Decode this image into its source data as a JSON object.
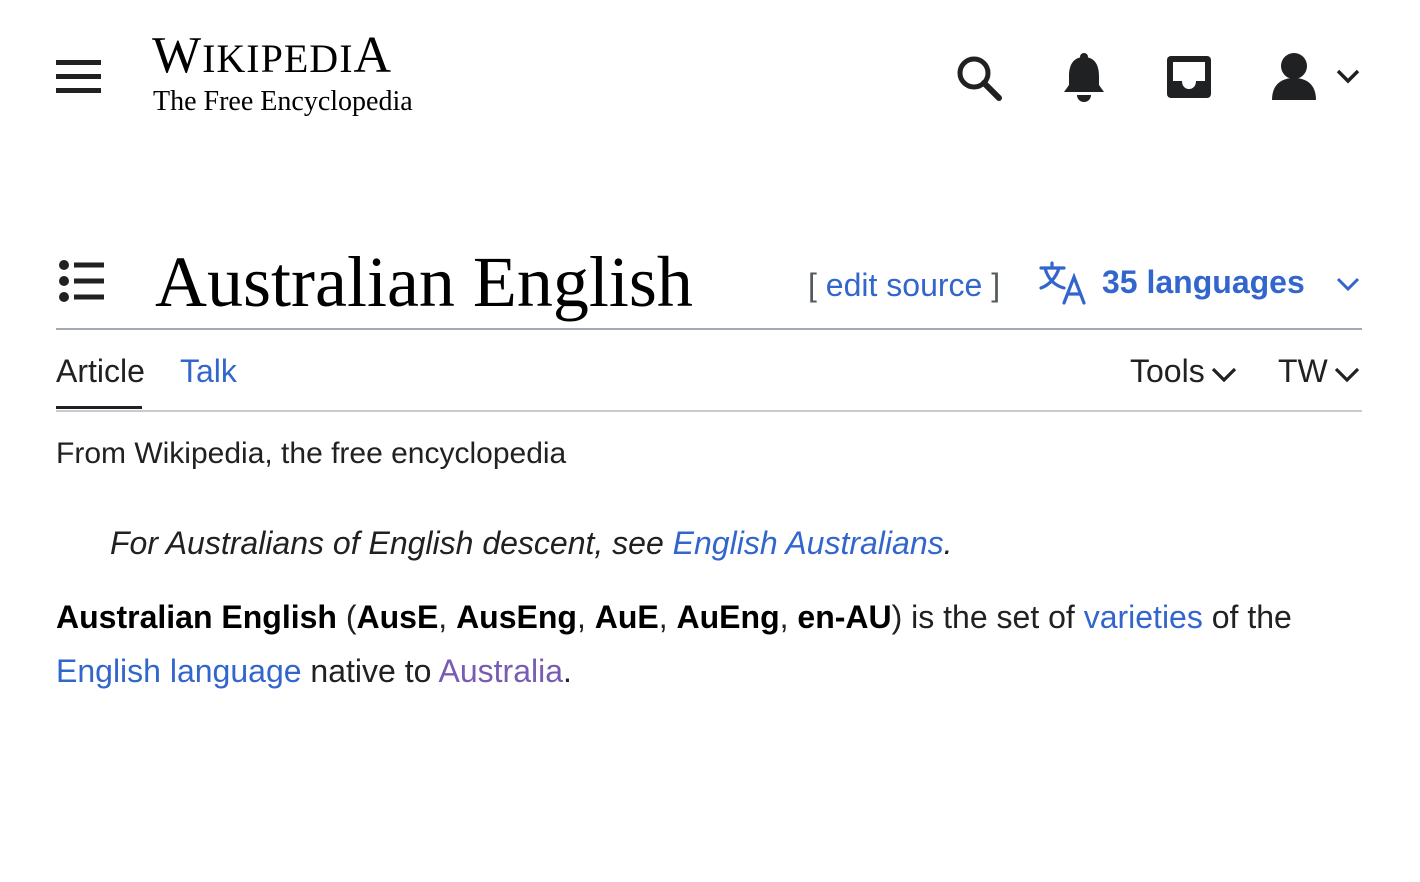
{
  "header": {
    "logo_word_first": "W",
    "logo_word_mid": "IKIPEDI",
    "logo_word_last": "A",
    "logo_tagline": "The Free Encyclopedia",
    "icons": [
      "menu-icon",
      "search-icon",
      "bell-icon",
      "inbox-icon",
      "user-icon",
      "chevron-down-icon"
    ]
  },
  "title_row": {
    "title": "Australian English",
    "edit_open": "[",
    "edit_label": "edit source",
    "edit_close": "]",
    "languages_label": "35 languages"
  },
  "tabs": {
    "article": "Article",
    "talk": "Talk",
    "tools": "Tools",
    "tw": "TW"
  },
  "content": {
    "tagline": "From Wikipedia, the free encyclopedia",
    "hatnote_text": "For Australians of English descent, see ",
    "hatnote_link": "English Australians",
    "hatnote_end": ".",
    "lead": {
      "b1": "Australian English",
      "t1": " (",
      "b2": "AusE",
      "t2": ", ",
      "b3": "AusEng",
      "t3": ", ",
      "b4": "AuE",
      "t4": ", ",
      "b5": "AuEng",
      "t5": ", ",
      "b6": "en-AU",
      "t6": ") is the set of ",
      "link1": "varieties",
      "t7": " of the ",
      "link2": "English language",
      "t8": " native to ",
      "link3": "Australia",
      "t9": "."
    }
  },
  "colors": {
    "link": "#3366cc",
    "visited_link": "#795cb2",
    "text": "#202122"
  }
}
